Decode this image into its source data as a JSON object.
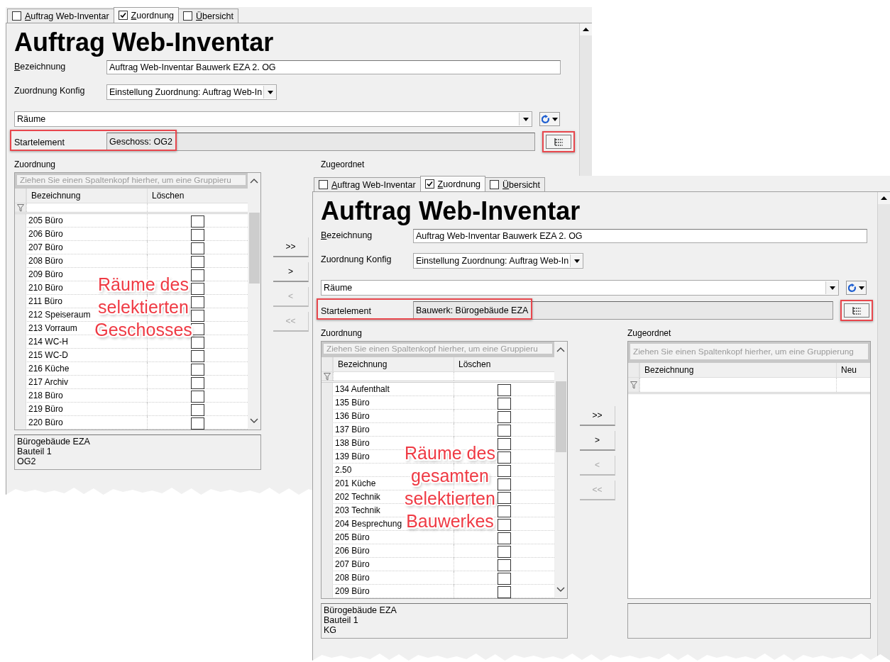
{
  "windows": [
    {
      "tabs": [
        {
          "label": "Auftrag Web-Inventar",
          "checked": false,
          "selected": false,
          "access_key": true
        },
        {
          "label": "Zuordnung",
          "checked": true,
          "selected": true,
          "access_key": true
        },
        {
          "label": "Übersicht",
          "checked": false,
          "selected": false,
          "access_key": true
        }
      ],
      "title": "Auftrag Web-Inventar",
      "name_field": {
        "label": "Bezeichnung",
        "access_key": true,
        "value": "Auftrag Web-Inventar Bauwerk EZA 2. OG"
      },
      "config_field": {
        "label": "Zuordnung Konfig",
        "value": "Einstellung Zuordnung: Auftrag Web-In"
      },
      "type_select": {
        "value": "Räume"
      },
      "start_element": {
        "label": "Startelement",
        "value": "Geschoss: OG2"
      },
      "source": {
        "label": "Zuordnung",
        "group_hint": "Ziehen Sie einen Spaltenkopf hierher, um eine Gruppieru",
        "columns": [
          "Bezeichnung",
          "Löschen"
        ],
        "rows": [
          {
            "name": "205 Büro",
            "checked": false
          },
          {
            "name": "206 Büro",
            "checked": false
          },
          {
            "name": "207 Büro",
            "checked": false
          },
          {
            "name": "208 Büro",
            "checked": false
          },
          {
            "name": "209 Büro",
            "checked": false
          },
          {
            "name": "210 Büro",
            "checked": false
          },
          {
            "name": "211 Büro",
            "checked": false
          },
          {
            "name": "212 Speiseraum",
            "checked": false
          },
          {
            "name": "213 Vorraum",
            "checked": false
          },
          {
            "name": "214 WC-H",
            "checked": false
          },
          {
            "name": "215 WC-D",
            "checked": false
          },
          {
            "name": "216 Küche",
            "checked": false
          },
          {
            "name": "217 Archiv",
            "checked": false
          },
          {
            "name": "218 Büro",
            "checked": false
          },
          {
            "name": "219 Büro",
            "checked": false
          },
          {
            "name": "220 Büro",
            "checked": false
          }
        ],
        "path": [
          "Bürogebäude EZA",
          "Bauteil 1",
          "OG2"
        ]
      },
      "transfer_buttons": [
        {
          "label": ">>",
          "disabled": false
        },
        {
          "label": ">",
          "disabled": false
        },
        {
          "label": "<",
          "disabled": true
        },
        {
          "label": "<<",
          "disabled": true
        }
      ],
      "target": {
        "label": "Zugeordnet"
      },
      "callout": [
        "Räume des",
        "selektierten",
        "Geschosses"
      ]
    },
    {
      "tabs": [
        {
          "label": "Auftrag Web-Inventar",
          "checked": false,
          "selected": false,
          "access_key": true
        },
        {
          "label": "Zuordnung",
          "checked": true,
          "selected": true,
          "access_key": true
        },
        {
          "label": "Übersicht",
          "checked": false,
          "selected": false,
          "access_key": true
        }
      ],
      "title": "Auftrag Web-Inventar",
      "name_field": {
        "label": "Bezeichnung",
        "access_key": true,
        "value": "Auftrag Web-Inventar Bauwerk EZA 2. OG"
      },
      "config_field": {
        "label": "Zuordnung Konfig",
        "value": "Einstellung Zuordnung: Auftrag Web-In"
      },
      "type_select": {
        "value": "Räume"
      },
      "start_element": {
        "label": "Startelement",
        "value": "Bauwerk: Bürogebäude EZA"
      },
      "source": {
        "label": "Zuordnung",
        "group_hint": "Ziehen Sie einen Spaltenkopf hierher, um eine Gruppieru",
        "columns": [
          "Bezeichnung",
          "Löschen"
        ],
        "rows": [
          {
            "name": "134 Aufenthalt",
            "checked": false
          },
          {
            "name": "135 Büro",
            "checked": false
          },
          {
            "name": "136 Büro",
            "checked": false
          },
          {
            "name": "137 Büro",
            "checked": false
          },
          {
            "name": "138 Büro",
            "checked": false
          },
          {
            "name": "139 Büro",
            "checked": false
          },
          {
            "name": "2.50",
            "checked": false
          },
          {
            "name": "201 Küche",
            "checked": false
          },
          {
            "name": "202 Technik",
            "checked": false
          },
          {
            "name": "203 Technik",
            "checked": false
          },
          {
            "name": "204 Besprechung",
            "checked": false
          },
          {
            "name": "205 Büro",
            "checked": false
          },
          {
            "name": "206 Büro",
            "checked": false
          },
          {
            "name": "207 Büro",
            "checked": false
          },
          {
            "name": "208 Büro",
            "checked": false
          },
          {
            "name": "209 Büro",
            "checked": false
          }
        ],
        "path": [
          "Bürogebäude EZA",
          "Bauteil 1",
          "KG"
        ]
      },
      "transfer_buttons": [
        {
          "label": ">>",
          "disabled": false
        },
        {
          "label": ">",
          "disabled": false
        },
        {
          "label": "<",
          "disabled": true
        },
        {
          "label": "<<",
          "disabled": true
        }
      ],
      "target": {
        "label": "Zugeordnet",
        "group_hint": "Ziehen Sie einen Spaltenkopf hierher, um eine Gruppierung",
        "columns": [
          "Bezeichnung",
          "Neu"
        ]
      },
      "callout": [
        "Räume des",
        "gesamten",
        "selektierten",
        "Bauwerkes"
      ]
    }
  ]
}
